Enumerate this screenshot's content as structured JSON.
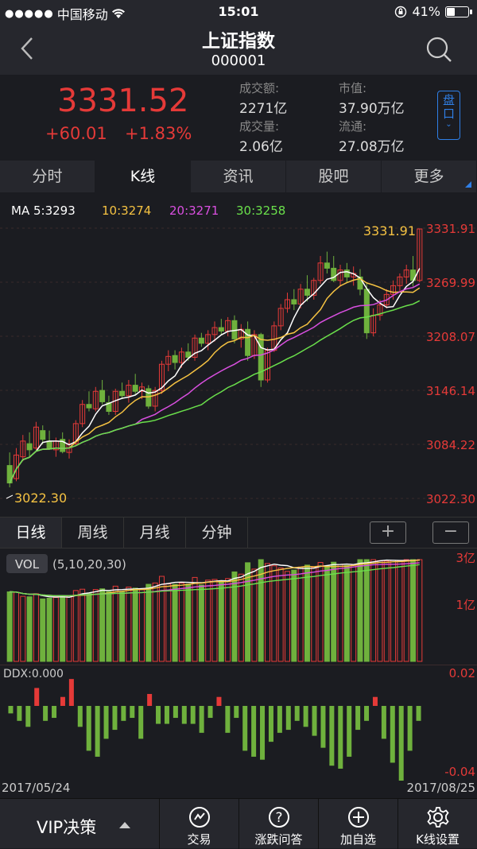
{
  "status": {
    "carrier": "中国移动",
    "time": "15:01",
    "battery": "41%",
    "battery_level": 0.41
  },
  "nav": {
    "title": "上证指数",
    "code": "000001"
  },
  "quote": {
    "price": "3331.52",
    "change": "+60.01",
    "percent": "+1.83%",
    "turnover_label": "成交额:",
    "turnover": "2271亿",
    "volume_label": "成交量:",
    "volume": "2.06亿",
    "mcap_label": "市值:",
    "mcap": "37.90万亿",
    "float_label": "流通:",
    "float": "27.08万亿",
    "pankou_label": "盘口",
    "up_color": "#e53a38",
    "down_color": "#6fb13d"
  },
  "tabs": [
    "分时",
    "K线",
    "资讯",
    "股吧",
    "更多"
  ],
  "ma_legend": [
    {
      "label": "MA 5:3293",
      "color": "#ffffff"
    },
    {
      "label": "10:3274",
      "color": "#f5c242"
    },
    {
      "label": "20:3271",
      "color": "#d94fe0"
    },
    {
      "label": "30:3258",
      "color": "#6ae04b"
    }
  ],
  "kline": {
    "high_label": "3331.91",
    "low_label": "3022.30",
    "price_axis": [
      "3331.91",
      "3269.99",
      "3208.07",
      "3146.14",
      "3084.22",
      "3022.30"
    ]
  },
  "periods": [
    "日线",
    "周线",
    "月线",
    "分钟"
  ],
  "zoom": {
    "in": "+",
    "out": "−"
  },
  "vol": {
    "badge": "VOL",
    "params": "(5,10,20,30)",
    "top": "3亿",
    "mid": "1亿"
  },
  "ddx": {
    "label": "DDX:0.000",
    "top": "0.02",
    "bottom": "-0.04"
  },
  "dates": {
    "start": "2017/05/24",
    "end": "2017/08/25"
  },
  "bottom": {
    "vip": "VIP决策",
    "items": [
      {
        "label": "交易",
        "icon": "trade-icon"
      },
      {
        "label": "涨跌问答",
        "icon": "question-icon"
      },
      {
        "label": "加自选",
        "icon": "add-icon"
      },
      {
        "label": "K线设置",
        "icon": "gear-icon"
      }
    ]
  },
  "chart_data": {
    "type": "candlestick",
    "ylim": [
      3022.3,
      3331.91
    ],
    "x_range": [
      "2017/05/24",
      "2017/08/25"
    ],
    "ohlc": [
      [
        3060,
        3075,
        3035,
        3040
      ],
      [
        3045,
        3080,
        3042,
        3072
      ],
      [
        3070,
        3095,
        3065,
        3088
      ],
      [
        3085,
        3098,
        3070,
        3078
      ],
      [
        3080,
        3110,
        3078,
        3104
      ],
      [
        3100,
        3106,
        3084,
        3090
      ],
      [
        3088,
        3100,
        3078,
        3080
      ],
      [
        3078,
        3092,
        3070,
        3088
      ],
      [
        3090,
        3098,
        3074,
        3076
      ],
      [
        3075,
        3090,
        3068,
        3085
      ],
      [
        3085,
        3112,
        3082,
        3108
      ],
      [
        3108,
        3135,
        3104,
        3130
      ],
      [
        3130,
        3145,
        3122,
        3126
      ],
      [
        3125,
        3150,
        3122,
        3145
      ],
      [
        3146,
        3158,
        3130,
        3133
      ],
      [
        3132,
        3140,
        3118,
        3122
      ],
      [
        3122,
        3148,
        3118,
        3145
      ],
      [
        3145,
        3155,
        3136,
        3140
      ],
      [
        3140,
        3158,
        3132,
        3152
      ],
      [
        3152,
        3165,
        3142,
        3145
      ],
      [
        3145,
        3155,
        3136,
        3150
      ],
      [
        3148,
        3152,
        3125,
        3128
      ],
      [
        3128,
        3150,
        3122,
        3146
      ],
      [
        3146,
        3180,
        3142,
        3176
      ],
      [
        3176,
        3192,
        3168,
        3185
      ],
      [
        3186,
        3192,
        3170,
        3178
      ],
      [
        3178,
        3195,
        3172,
        3190
      ],
      [
        3190,
        3200,
        3180,
        3184
      ],
      [
        3184,
        3210,
        3180,
        3206
      ],
      [
        3206,
        3212,
        3196,
        3200
      ],
      [
        3200,
        3215,
        3192,
        3210
      ],
      [
        3210,
        3225,
        3202,
        3218
      ],
      [
        3218,
        3228,
        3210,
        3214
      ],
      [
        3214,
        3230,
        3208,
        3226
      ],
      [
        3226,
        3232,
        3200,
        3205
      ],
      [
        3205,
        3222,
        3195,
        3216
      ],
      [
        3216,
        3225,
        3180,
        3186
      ],
      [
        3186,
        3215,
        3182,
        3210
      ],
      [
        3210,
        3212,
        3150,
        3158
      ],
      [
        3158,
        3195,
        3155,
        3192
      ],
      [
        3192,
        3225,
        3190,
        3220
      ],
      [
        3220,
        3245,
        3215,
        3240
      ],
      [
        3240,
        3258,
        3235,
        3250
      ],
      [
        3250,
        3262,
        3238,
        3245
      ],
      [
        3245,
        3268,
        3240,
        3262
      ],
      [
        3262,
        3278,
        3248,
        3255
      ],
      [
        3255,
        3275,
        3250,
        3272
      ],
      [
        3272,
        3300,
        3268,
        3292
      ],
      [
        3292,
        3305,
        3280,
        3286
      ],
      [
        3286,
        3300,
        3270,
        3272
      ],
      [
        3272,
        3290,
        3265,
        3284
      ],
      [
        3284,
        3292,
        3270,
        3276
      ],
      [
        3276,
        3288,
        3266,
        3280
      ],
      [
        3276,
        3285,
        3255,
        3262
      ],
      [
        3262,
        3270,
        3205,
        3212
      ],
      [
        3212,
        3240,
        3208,
        3232
      ],
      [
        3232,
        3250,
        3226,
        3244
      ],
      [
        3244,
        3262,
        3240,
        3256
      ],
      [
        3256,
        3272,
        3250,
        3266
      ],
      [
        3266,
        3280,
        3260,
        3276
      ],
      [
        3276,
        3290,
        3268,
        3284
      ],
      [
        3284,
        3300,
        3265,
        3272
      ],
      [
        3272,
        3331,
        3270,
        3331
      ]
    ],
    "ddx": [
      -0.005,
      -0.01,
      -0.014,
      0.012,
      -0.01,
      -0.008,
      0.006,
      0.018,
      -0.014,
      -0.03,
      -0.034,
      -0.022,
      -0.016,
      -0.01,
      -0.008,
      -0.022,
      0.008,
      -0.012,
      -0.012,
      -0.008,
      -0.012,
      -0.012,
      -0.018,
      -0.008,
      0.006,
      -0.018,
      -0.008,
      -0.03,
      -0.034,
      -0.036,
      -0.024,
      -0.018,
      -0.016,
      -0.01,
      -0.014,
      -0.02,
      -0.028,
      -0.04,
      -0.042,
      -0.034,
      -0.016,
      -0.01,
      0.006,
      -0.022,
      -0.038,
      -0.05,
      -0.03,
      -0.01
    ]
  }
}
